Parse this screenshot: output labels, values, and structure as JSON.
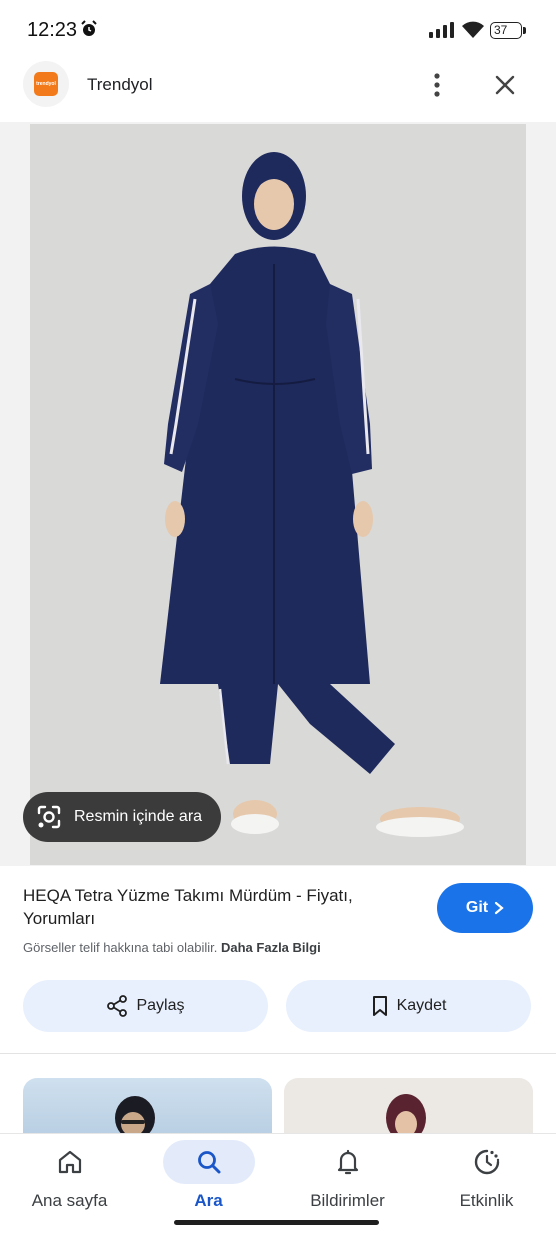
{
  "status_bar": {
    "time": "12:23",
    "battery": "37"
  },
  "header": {
    "site_name": "Trendyol",
    "logo_text": "trendyol"
  },
  "lens_chip": {
    "label": "Resmin içinde ara"
  },
  "result": {
    "title": "HEQA Tetra Yüzme Takımı Mürdüm - Fiyatı, Yorumları",
    "go_label": "Git",
    "copyright_note": "Görseller telif hakkına tabi olabilir.",
    "more_info": "Daha Fazla Bilgi"
  },
  "actions": {
    "share_label": "Paylaş",
    "save_label": "Kaydet"
  },
  "nav": {
    "items": [
      {
        "label": "Ana sayfa",
        "icon": "home-icon"
      },
      {
        "label": "Ara",
        "icon": "search-icon",
        "active": true
      },
      {
        "label": "Bildirimler",
        "icon": "bell-icon"
      },
      {
        "label": "Etkinlik",
        "icon": "activity-icon"
      }
    ]
  },
  "colors": {
    "accent": "#1a73e8",
    "active_nav_bg": "#e3ebfb",
    "chip_bg": "#e8f0fe",
    "garment": "#1f2a5c"
  }
}
